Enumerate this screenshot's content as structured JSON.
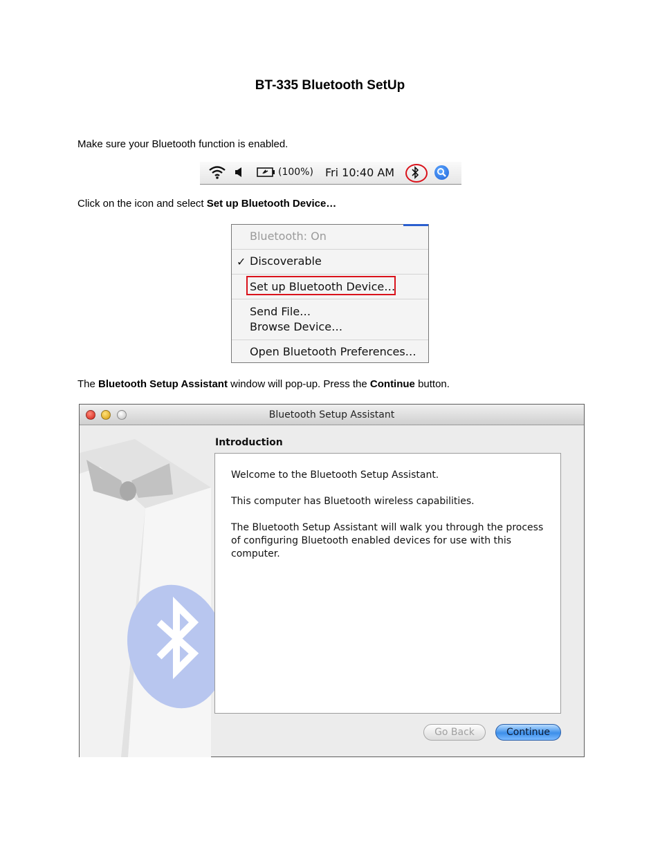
{
  "document": {
    "title": "BT-335 Bluetooth SetUp",
    "para1": "Make sure your Bluetooth function is enabled.",
    "para2": {
      "prefix": "Click on the icon and select ",
      "bold": "Set up Bluetooth Device…"
    },
    "para3": {
      "t1": "The ",
      "b1": "Bluetooth Setup Assistant",
      "t2": " window will pop-up. Press the ",
      "b2": "Continue",
      "t3": " button."
    }
  },
  "menubar": {
    "battery": "(100%)",
    "clock": "Fri 10:40 AM",
    "icons": [
      "wifi-icon",
      "volume-icon",
      "battery-icon",
      "bluetooth-icon",
      "spotlight-icon"
    ],
    "highlight_color": "#d9121b"
  },
  "bt_menu": {
    "status": "Bluetooth: On",
    "check": "✓",
    "discoverable": "Discoverable",
    "setup_device": "Set up Bluetooth Device…",
    "send_file": "Send File…",
    "browse_device": "Browse Device…",
    "open_prefs": "Open Bluetooth Preferences…"
  },
  "window": {
    "title": "Bluetooth Setup Assistant",
    "section": "Introduction",
    "welcome": "Welcome to the Bluetooth Setup Assistant.",
    "capabilities": "This computer has Bluetooth wireless capabilities.",
    "walk": "The Bluetooth Setup Assistant will walk you through the process of configuring Bluetooth enabled devices for use with this computer.",
    "go_back": "Go Back",
    "continue": "Continue",
    "accent": "#3d8fea"
  }
}
